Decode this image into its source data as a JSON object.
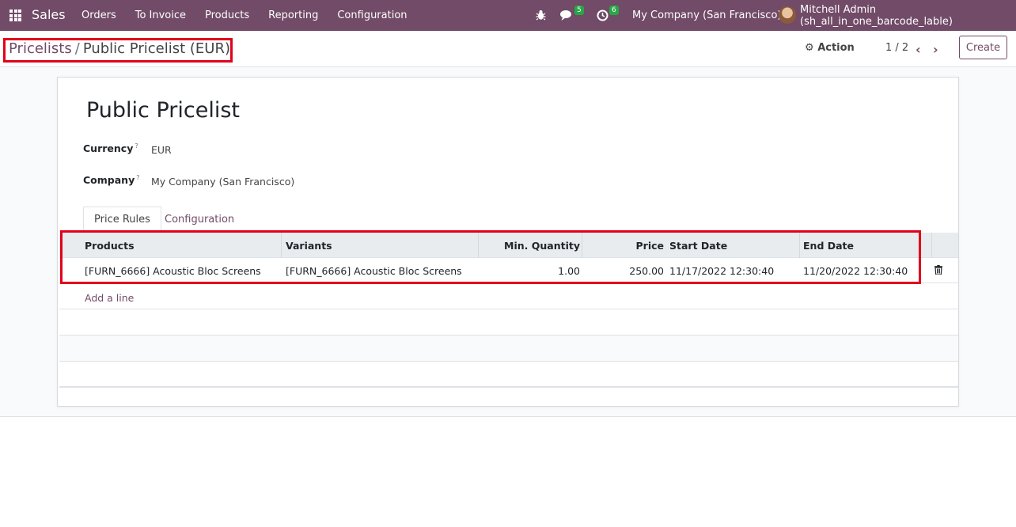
{
  "navbar": {
    "app_name": "Sales",
    "menu": [
      "Orders",
      "To Invoice",
      "Products",
      "Reporting",
      "Configuration"
    ],
    "chat_count": "5",
    "activity_count": "6",
    "company": "My Company (San Francisco)",
    "user": "Mitchell Admin (sh_all_in_one_barcode_lable)"
  },
  "control": {
    "breadcrumb_parent": "Pricelists",
    "breadcrumb_sep": "/",
    "breadcrumb_current": "Public Pricelist (EUR)",
    "action_label": "Action",
    "pager": "1 / 2",
    "create_label": "Create"
  },
  "form": {
    "title": "Public Pricelist",
    "currency_label": "Currency",
    "currency_value": "EUR",
    "company_label": "Company",
    "company_value": "My Company (San Francisco)",
    "help_mark": "?"
  },
  "tabs": [
    "Price Rules",
    "Configuration"
  ],
  "table": {
    "headers": [
      "Products",
      "Variants",
      "Min. Quantity",
      "Price",
      "Start Date",
      "End Date"
    ],
    "rows": [
      [
        "[FURN_6666] Acoustic Bloc Screens",
        "[FURN_6666] Acoustic Bloc Screens",
        "1.00",
        "250.00",
        "11/17/2022 12:30:40",
        "11/20/2022 12:30:40"
      ]
    ],
    "add_line": "Add a line"
  },
  "colors": {
    "brand": "#714b67",
    "highlight": "#e2001a",
    "badge": "#28a745"
  }
}
